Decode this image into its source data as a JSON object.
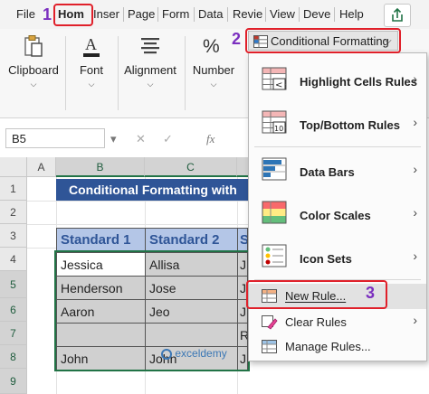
{
  "tabs": [
    "File",
    "Hom",
    "Inser",
    "Page",
    "Form",
    "Data",
    "Revie",
    "View",
    "Deve",
    "Help"
  ],
  "ribbon": {
    "clipboard": "Clipboard",
    "font": "Font",
    "alignment": "Alignment",
    "number": "Number",
    "percent_symbol": "%"
  },
  "conditional_formatting_button": "Conditional Formatting",
  "menu": {
    "highlight": "Highlight Cells Rules",
    "topbottom": "Top/Bottom Rules",
    "databars": "Data Bars",
    "colorscales": "Color Scales",
    "iconsets": "Icon Sets",
    "newrule": "New Rule...",
    "clearrules": "Clear Rules",
    "managerules": "Manage Rules..."
  },
  "formula_bar": {
    "name_box": "B5",
    "fx": "fx"
  },
  "grid": {
    "columns": [
      "A",
      "B",
      "C"
    ],
    "rows": [
      "1",
      "2",
      "3",
      "4",
      "5",
      "6",
      "7",
      "8",
      "9"
    ],
    "title": "Conditional Formatting with",
    "headers": [
      "Standard 1",
      "Standard 2",
      "S"
    ],
    "col_b": [
      "Jessica",
      "Henderson",
      "Aaron",
      "",
      "John"
    ],
    "col_c": [
      "Allisa",
      "Jose",
      "Jeo",
      "",
      "John"
    ],
    "col_d": [
      "J",
      "J",
      "J",
      "R",
      "J"
    ]
  },
  "steps": [
    "1",
    "2",
    "3"
  ],
  "watermark": "exceldemy",
  "colors": {
    "accent": "#217346",
    "title_bg": "#2f5597",
    "header_bg": "#b4c6e7",
    "highlight": "#e0202a",
    "step": "#7b2fbf"
  }
}
